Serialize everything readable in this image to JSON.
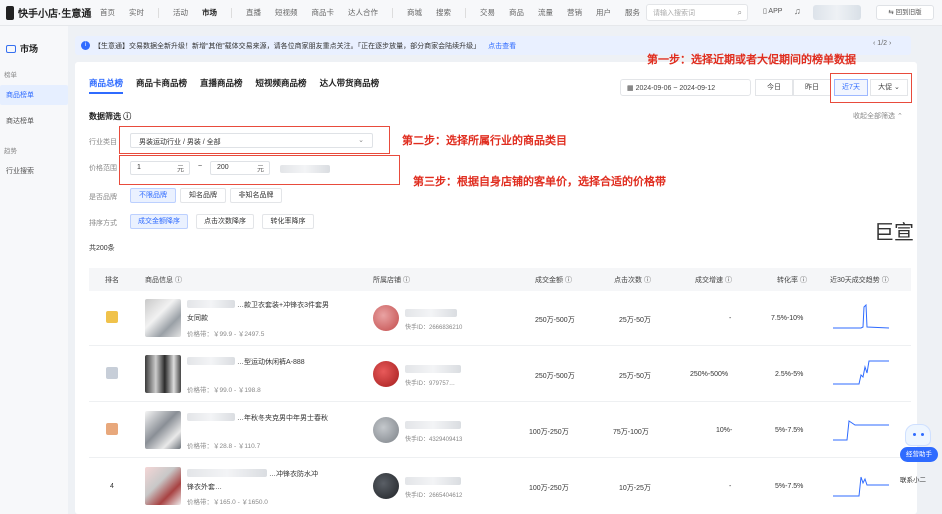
{
  "topbar": {
    "app_name": "快手小店·生意通",
    "nav": [
      "首页",
      "实时",
      "活动",
      "市场",
      "直播",
      "短视频",
      "商品卡",
      "达人合作",
      "商城",
      "搜索",
      "交易",
      "商品",
      "流量",
      "营销",
      "用户",
      "服务"
    ],
    "active_nav": "市场",
    "search_placeholder": "请输入搜索词",
    "app_label": "APP",
    "old_version_label": "回到旧版"
  },
  "sidebar": {
    "title": "市场",
    "groups": [
      {
        "label": "榜单",
        "items": [
          "商品榜单",
          "商达榜单"
        ]
      },
      {
        "label": "趋势",
        "items": [
          "行业搜索"
        ]
      }
    ],
    "active_item": "商品榜单"
  },
  "notice": {
    "text": "【生意通】交易数据全新升级！新增“其他”载体交易来源，请各位商家朋友重点关注。「正在逐步放量，部分商家会陆续升级」",
    "link": "点击查看",
    "pager": "1/2"
  },
  "tabs": [
    "商品总榜",
    "商品卡商品榜",
    "直播商品榜",
    "短视频商品榜",
    "达人带货商品榜"
  ],
  "active_tab": "商品总榜",
  "date": {
    "range": "2024-09-06  ~  2024-09-12",
    "options": [
      "今日",
      "昨日",
      "近7天",
      "大促"
    ],
    "active": "近7天"
  },
  "annotations": {
    "step1": "第一步：选择近期或者大促期间的榜单数据",
    "step2": "第二步：选择所属行业的商品类目",
    "step3": "第三步：根据自身店铺的客单价，选择合适的价格带",
    "watermark": "巨宣"
  },
  "filters": {
    "title": "数据筛选",
    "collapse_label": "收起全部筛选",
    "industry_label": "行业类目",
    "industry_value": "男装运动行业 / 男装 / 全部",
    "price_label": "价格范围",
    "price_min": "1",
    "price_max": "200",
    "price_unit": "元",
    "price_dash": "~",
    "brand_label": "是否品牌",
    "brand_options": [
      "不限品牌",
      "知名品牌",
      "非知名品牌"
    ],
    "brand_active": "不限品牌",
    "sort_label": "排序方式",
    "sort_options": [
      "成交金额降序",
      "点击次数降序",
      "转化率降序"
    ],
    "sort_active": "成交金额降序"
  },
  "total": "共200条",
  "table": {
    "headers": [
      "排名",
      "商品信息",
      "所属店铺",
      "成交金额",
      "点击次数",
      "成交增速",
      "转化率",
      "近30天成交趋势"
    ],
    "rows": [
      {
        "rank": "1",
        "title": "…款卫衣套装+冲锋衣3件套男",
        "title2": "女同款",
        "price": "价格带：￥99.9 - ￥2497.5",
        "shop_id": "快手ID：2666836210",
        "gmv": "250万-500万",
        "clicks": "25万-50万",
        "growth": "-",
        "cvr": "7.5%-10%"
      },
      {
        "rank": "2",
        "title": "…型运动休闲裤A-888",
        "title2": "",
        "price": "价格带：￥99.0 - ￥198.8",
        "shop_id": "快手ID：979757…",
        "gmv": "250万-500万",
        "clicks": "25万-50万",
        "growth": "250%-500%",
        "cvr": "2.5%-5%"
      },
      {
        "rank": "3",
        "title": "…年秋冬夹克男中年男士春秋",
        "title2": "",
        "price": "价格带：￥28.8 - ￥110.7",
        "shop_id": "快手ID：4329409413",
        "gmv": "100万-250万",
        "clicks": "75万-100万",
        "growth": "10%-",
        "cvr": "5%-7.5%"
      },
      {
        "rank": "4",
        "title": "…冲锋衣防水冲",
        "title2": "锋衣外套…",
        "price": "价格带：￥165.0 - ￥1650.0",
        "shop_id": "快手ID：2665404612",
        "gmv": "100万-250万",
        "clicks": "10万-25万",
        "growth": "-",
        "cvr": "5%-7.5%"
      }
    ]
  },
  "assistant": {
    "label": "经营助手",
    "contact": "联系小二"
  },
  "colors": {
    "accent": "#2f6bff",
    "annotation": "#e02d1f"
  }
}
